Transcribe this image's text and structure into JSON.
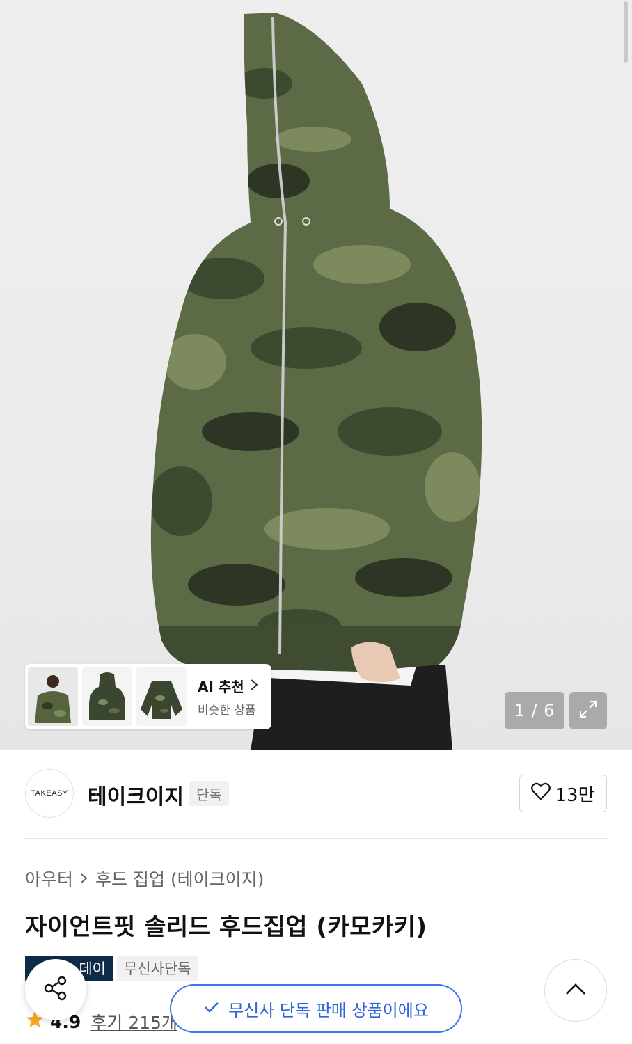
{
  "gallery": {
    "counter": "1 / 6",
    "ai_title": "AI 추천",
    "ai_subtitle": "비슷한 상품"
  },
  "brand": {
    "logo_text": "TAKEASY",
    "name": "테이크이지",
    "badge": "단독",
    "likes": "13만"
  },
  "breadcrumb": [
    "아우터",
    "후드 집업 (테이크이지)"
  ],
  "product": {
    "title": "자이언트핏 솔리드 후드집업 (카모카키)",
    "tags": [
      "데이",
      "무신사단독"
    ]
  },
  "rating": {
    "score": "4.9",
    "reviews": "후기 215개"
  },
  "toast": {
    "message": "무신사 단독 판매 상품이에요"
  },
  "icons": [
    "heart-icon",
    "share-icon",
    "chevron-up-icon",
    "expand-icon",
    "chevron-right-icon",
    "check-icon",
    "star-icon"
  ],
  "colors": {
    "camo_dark": "#3c4a2f",
    "camo_mid": "#5c6a45",
    "camo_light": "#7d8a5e",
    "tag_dark": "#0f2b4a",
    "toast_blue": "#3a74f0",
    "star": "#f5a623"
  }
}
